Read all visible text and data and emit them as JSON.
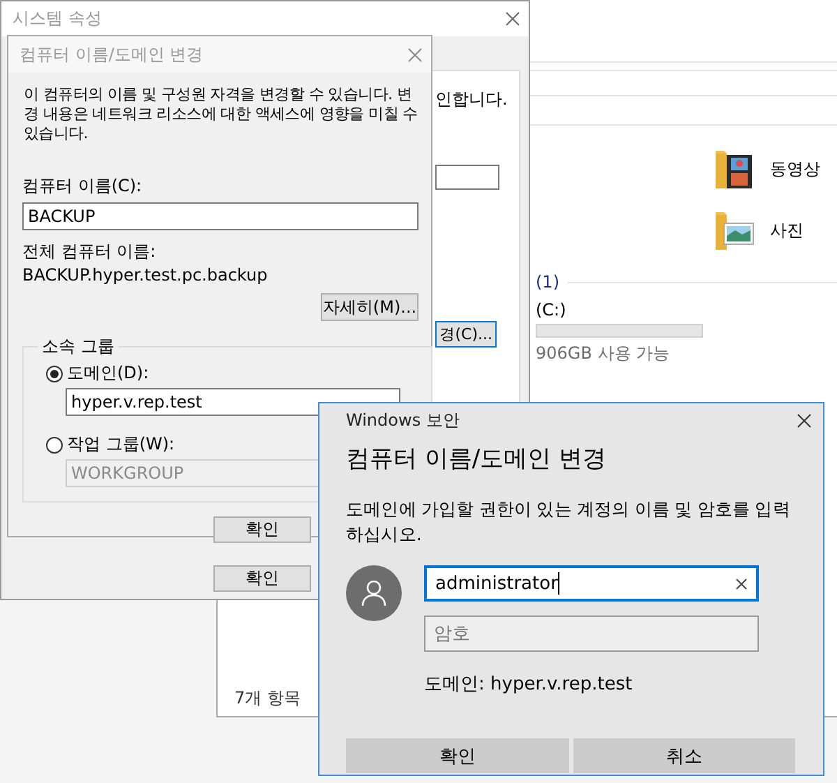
{
  "explorer": {
    "folders": [
      {
        "label": "동영상",
        "kind": "videos"
      },
      {
        "label": "사진",
        "kind": "pictures"
      }
    ],
    "drive_group": "(1)",
    "drive_name": "(C:)",
    "drive_space": "906GB 사용 가능",
    "status_bar": "7개 항목"
  },
  "system_properties": {
    "title": "시스템 속성",
    "partial_text": "인합니다.",
    "change_button": "경(C)...",
    "ok_button": "확인"
  },
  "change_dialog": {
    "title": "컴퓨터 이름/도메인 변경",
    "description": "이 컴퓨터의 이름 및 구성원 자격을 변경할 수 있습니다. 변경 내용은 네트워크 리소스에 대한 액세스에 영향을 미칠 수 있습니다.",
    "computer_name_label": "컴퓨터 이름(C):",
    "computer_name": "BACKUP",
    "full_name_label": "전체 컴퓨터 이름:",
    "full_name": "BACKUP.hyper.test.pc.backup",
    "more_button": "자세히(M)...",
    "group_title": "소속 그룹",
    "options": [
      {
        "label": "도메인(D):",
        "selected": true,
        "value": "hyper.v.rep.test",
        "disabled": false
      },
      {
        "label": "작업 그룹(W):",
        "selected": false,
        "value": "WORKGROUP",
        "disabled": true
      }
    ],
    "ok_button": "확인"
  },
  "security_dialog": {
    "app_title": "Windows 보안",
    "heading": "컴퓨터 이름/도메인 변경",
    "prompt": "도메인에 가입할 권한이 있는 계정의 이름 및 암호를 입력하십시오.",
    "username": "administrator",
    "password_placeholder": "암호",
    "domain_text": "도메인: hyper.v.rep.test",
    "buttons": [
      "확인",
      "취소"
    ]
  }
}
